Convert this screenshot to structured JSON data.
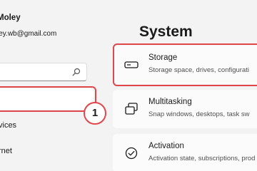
{
  "profile": {
    "name": "Moley",
    "email": "ley.wb@gmail.com"
  },
  "search": {
    "placeholder": "",
    "icon": "search-icon"
  },
  "sidebar": {
    "items": [
      {
        "label": "",
        "icon": "",
        "selected": true
      },
      {
        "label": "vices"
      },
      {
        "label": "rnet"
      }
    ]
  },
  "annotation": {
    "number": "1",
    "color": "#e0474c"
  },
  "page": {
    "title": "System"
  },
  "settings": [
    {
      "title": "Storage",
      "description": "Storage space, drives, configurati",
      "icon": "drive-icon"
    },
    {
      "title": "Multitasking",
      "description": "Snap windows, desktops, task sw",
      "icon": "multitasking-icon"
    },
    {
      "title": "Activation",
      "description": "Activation state, subscriptions, prod",
      "icon": "activation-icon"
    }
  ]
}
